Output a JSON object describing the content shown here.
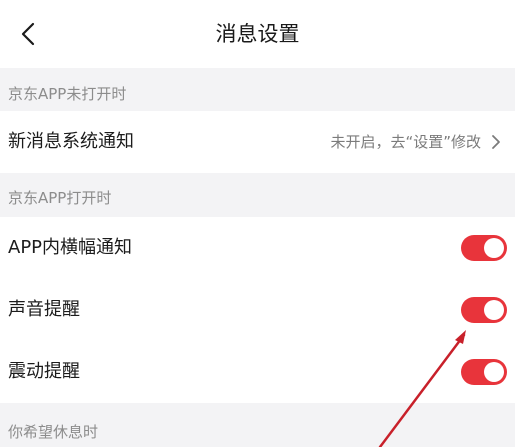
{
  "header": {
    "title": "消息设置",
    "back_icon": "chevron-left-icon"
  },
  "sections": [
    {
      "title": "京东APP未打开时",
      "rows": [
        {
          "label": "新消息系统通知",
          "value": "未开启，去“设置”修改",
          "icon": "chevron-right-icon"
        }
      ]
    },
    {
      "title": "京东APP打开时",
      "rows": [
        {
          "label": "APP内横幅通知",
          "enabled": true
        },
        {
          "label": "声音提醒",
          "enabled": true
        },
        {
          "label": "震动提醒",
          "enabled": true
        }
      ]
    },
    {
      "title": "你希望休息时",
      "rows": []
    }
  ],
  "colors": {
    "accent": "#e8343b",
    "annotation_arrow": "#c8202a",
    "background": "#f3f3f5",
    "secondary_text": "#8c8c8c"
  }
}
